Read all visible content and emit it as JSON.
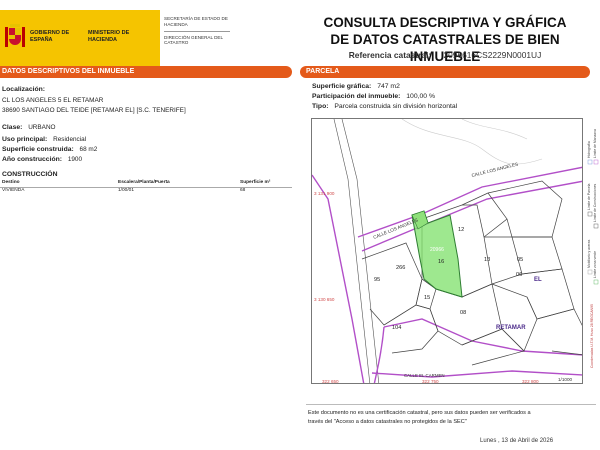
{
  "header": {
    "gobierno": "GOBIERNO DE ESPAÑA",
    "ministerio": "MINISTERIO DE HACIENDA",
    "secretaria": "SECRETARÍA DE ESTADO DE HACIENDA",
    "direccion": "DIRECCIÓN GENERAL DEL CATASTRO",
    "title_line1": "CONSULTA DESCRIPTIVA Y GRÁFICA",
    "title_line2": "DE DATOS CATASTRALES DE BIEN INMUEBLE",
    "ref_label": "Referencia catastral:",
    "ref_value": "2096616CS2229N0001UJ"
  },
  "left": {
    "section_title": "DATOS DESCRIPTIVOS DEL INMUEBLE",
    "localizacion_label": "Localización:",
    "address_line1": "CL LOS ANGELES 5 EL RETAMAR",
    "address_line2": "38690 SANTIAGO DEL TEIDE [RETAMAR EL] [S.C. TENERIFE]",
    "clase_label": "Clase:",
    "clase_value": "URBANO",
    "uso_label": "Uso principal:",
    "uso_value": "Residencial",
    "superficie_label": "Superficie construida:",
    "superficie_value": "68 m2",
    "anio_label": "Año construcción:",
    "anio_value": "1900",
    "construccion_title": "CONSTRUCCIÓN",
    "table_headers": [
      "Destino",
      "Escalera/Planta/Puerta",
      "Superficie m²"
    ],
    "table_rows": [
      [
        "VIVIENDA",
        "1/00/01",
        "68"
      ]
    ]
  },
  "right": {
    "section_title": "PARCELA",
    "sup_grafica_label": "Superficie gráfica:",
    "sup_grafica_value": "747 m2",
    "participacion_label": "Participación del inmueble:",
    "participacion_value": "100,00 %",
    "tipo_label": "Tipo:",
    "tipo_value": "Parcela construida sin división horizontal"
  },
  "map": {
    "street_1": "CALLE LOS ANGELES",
    "street_2": "CALLE LOS ANGELES",
    "street_3": "CALLE EL CARMEN",
    "coord_y1": "3 131 900",
    "coord_y2": "3 130 650",
    "coord_x1": "322 650",
    "coord_x2": "322 750",
    "coord_x3": "322 800",
    "locality_el": "EL",
    "locality_retamar": "RETAMAR",
    "parcel_labels": [
      "12",
      "13",
      "16",
      "15",
      "06",
      "08",
      "95",
      "104",
      "266",
      "05"
    ],
    "highlight_label": "20966",
    "scale": "1/1000",
    "legend_items": [
      "Hidrografía",
      "Límite de Manzana",
      "Límite de Parcela",
      "Límite de Construcciones",
      "Mobiliario y aceras",
      "Límite zona verde"
    ],
    "coord_note": "Coordenadas U.T.M. Huso 28 REGCAN95",
    "accent_purple": "#b24fc8",
    "highlight_green": "#7ee06a"
  },
  "footer": {
    "disclaimer_1": "Este documento no es una certificación catastral, pero sus datos pueden ser verificados a",
    "disclaimer_2": "través del \"Acceso a datos catastrales no protegidos de la SEC\"",
    "date": "Lunes , 13 de Abril de 2026"
  }
}
